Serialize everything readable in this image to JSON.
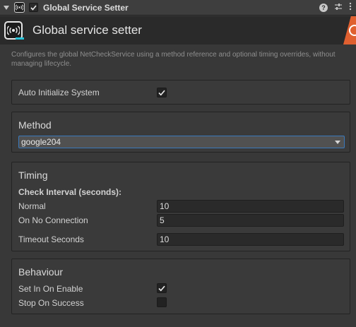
{
  "component": {
    "title": "Global Service Setter",
    "enabled": true,
    "icon": "broadcast-icon",
    "tools": [
      "help-icon",
      "preset-icon",
      "more-menu-icon"
    ]
  },
  "banner": {
    "title": "Global service setter",
    "accent_color": "#e06030"
  },
  "description": "Configures the global NetCheckService using a method reference and optional timing overrides, without managing lifecycle.",
  "auto_init": {
    "label": "Auto Initialize System",
    "checked": true
  },
  "method": {
    "title": "Method",
    "selected": "google204"
  },
  "timing": {
    "title": "Timing",
    "check_interval_label": "Check Interval (seconds):",
    "normal_label": "Normal",
    "normal_value": "10",
    "no_connection_label": "On No Connection",
    "no_connection_value": "5",
    "timeout_label": "Timeout Seconds",
    "timeout_value": "10"
  },
  "behaviour": {
    "title": "Behaviour",
    "set_on_enable_label": "Set In On Enable",
    "set_on_enable_checked": true,
    "stop_on_success_label": "Stop On Success",
    "stop_on_success_checked": false
  }
}
